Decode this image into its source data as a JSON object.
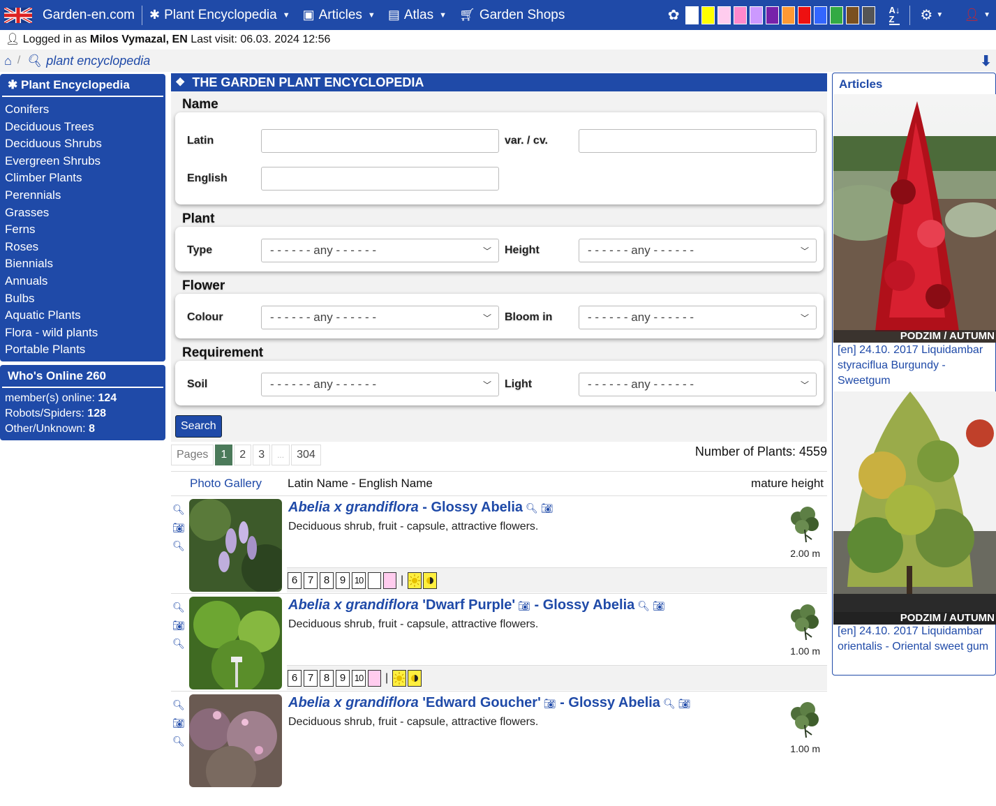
{
  "topnav": {
    "brand": "Garden-en.com",
    "items": [
      {
        "label": "Plant Encyclopedia",
        "icon": "snowflake-icon"
      },
      {
        "label": "Articles",
        "icon": "article-icon"
      },
      {
        "label": "Atlas",
        "icon": "atlas-icon"
      },
      {
        "label": "Garden Shops",
        "icon": "cart-icon"
      }
    ],
    "color_swatches": [
      "#ffffff",
      "#ffff00",
      "#ffccee",
      "#ff88cc",
      "#cc99ff",
      "#7722aa",
      "#ff9933",
      "#ee1111",
      "#3366ff",
      "#33aa44",
      "#7a5020",
      "#555555"
    ]
  },
  "login": {
    "prefix": "Logged in as",
    "user": "Milos Vymazal, EN",
    "last_visit": "Last visit: 06.03. 2024 12:56"
  },
  "breadcrumb": {
    "crumb": "plant encyclopedia"
  },
  "sidebar": {
    "title": "Plant Encyclopedia",
    "items": [
      "Conifers",
      "Deciduous Trees",
      "Deciduous Shrubs",
      "Evergreen Shrubs",
      "Climber Plants",
      "Perennials",
      "Grasses",
      "Ferns",
      "Roses",
      "Biennials",
      "Annuals",
      "Bulbs",
      "Aquatic Plants",
      "Flora - wild plants",
      "Portable Plants"
    ],
    "online_title": "Who's Online 260",
    "online": [
      {
        "label": "member(s) online:",
        "value": "124"
      },
      {
        "label": "Robots/Spiders:",
        "value": "128"
      },
      {
        "label": "Other/Unknown:",
        "value": "8"
      }
    ]
  },
  "main": {
    "title": "THE GARDEN PLANT ENCYCLOPEDIA",
    "name_legend": "Name",
    "latin_label": "Latin",
    "cv_label": "var. / cv.",
    "english_label": "English",
    "plant_legend": "Plant",
    "type_label": "Type",
    "height_label": "Height",
    "flower_legend": "Flower",
    "colour_label": "Colour",
    "bloom_label": "Bloom in",
    "req_legend": "Requirement",
    "soil_label": "Soil",
    "light_label": "Light",
    "any": "- - - - - - any - - - - - -",
    "search_button": "Search",
    "pages_label": "Pages",
    "pages": [
      "1",
      "2",
      "3",
      "...",
      "304"
    ],
    "plant_count": "Number of Plants: 4559",
    "col_gallery": "Photo Gallery",
    "col_name": "Latin Name - English Name",
    "col_height": "mature height"
  },
  "plants": [
    {
      "latin": "Abelia x grandiflora",
      "cultivar": "",
      "english": "Glossy Abelia",
      "desc": "Deciduous shrub, fruit - capsule, attractive flowers.",
      "height": "2.00 m",
      "zones": [
        "6",
        "7",
        "8",
        "9",
        "10"
      ],
      "colors": [
        "#ffffff",
        "#ffccee"
      ]
    },
    {
      "latin": "Abelia x grandiflora",
      "cultivar": "'Dwarf Purple'",
      "english": "Glossy Abelia",
      "desc": "Deciduous shrub, fruit - capsule, attractive flowers.",
      "height": "1.00 m",
      "zones": [
        "6",
        "7",
        "8",
        "9",
        "10"
      ],
      "colors": [
        "#ffccee"
      ]
    },
    {
      "latin": "Abelia x grandiflora",
      "cultivar": "'Edward Goucher'",
      "english": "Glossy Abelia",
      "desc": "Deciduous shrub, fruit - capsule, attractive flowers.",
      "height": "1.00 m",
      "zones": [],
      "colors": []
    }
  ],
  "articles": {
    "title": "Articles",
    "items": [
      {
        "caption": "PODZIM / AUTUMN",
        "text": "[en] 24.10. 2017 Liquidambar styraciflua Burgundy - Sweetgum"
      },
      {
        "caption": "PODZIM / AUTUMN",
        "text": "[en] 24.10. 2017 Liquidambar orientalis - Oriental sweet gum"
      }
    ]
  }
}
